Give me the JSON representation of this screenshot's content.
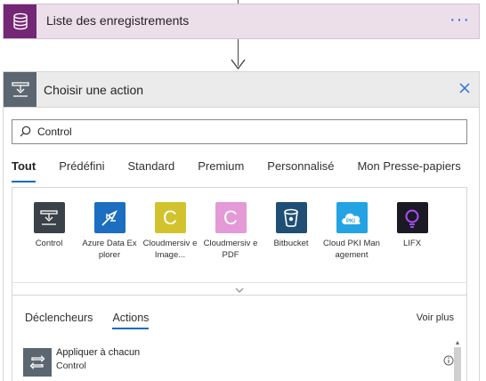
{
  "top_card": {
    "title": "Liste des enregistrements",
    "menu_label": "···"
  },
  "panel": {
    "title": "Choisir une action"
  },
  "search": {
    "value": "Control",
    "placeholder": ""
  },
  "tabs": [
    "Tout",
    "Prédéfini",
    "Standard",
    "Premium",
    "Personnalisé",
    "Mon Presse-papiers"
  ],
  "connectors": [
    {
      "label": "Control",
      "icon": "control-icon",
      "color": "#3a4149"
    },
    {
      "label": "Azure Data Explorer",
      "icon": "azure-data-explorer-icon",
      "color": "#1c6ec0"
    },
    {
      "label": "Cloudmersiv e Image...",
      "icon": "cloudmersive-image-icon",
      "color": "#d2c32e"
    },
    {
      "label": "Cloudmersiv e PDF",
      "icon": "cloudmersive-pdf-icon",
      "color": "#e39ad6"
    },
    {
      "label": "Bitbucket",
      "icon": "bitbucket-icon",
      "color": "#1f4f75"
    },
    {
      "label": "Cloud PKI Management",
      "icon": "cloud-pki-icon",
      "color": "#23a3e3"
    },
    {
      "label": "LIFX",
      "icon": "lifx-icon",
      "color": "#1a1a24"
    }
  ],
  "subtabs": [
    "Déclencheurs",
    "Actions"
  ],
  "see_more": "Voir plus",
  "action_row": {
    "title": "Appliquer à chacun",
    "subtitle": "Control",
    "icon": "loop-icon"
  }
}
